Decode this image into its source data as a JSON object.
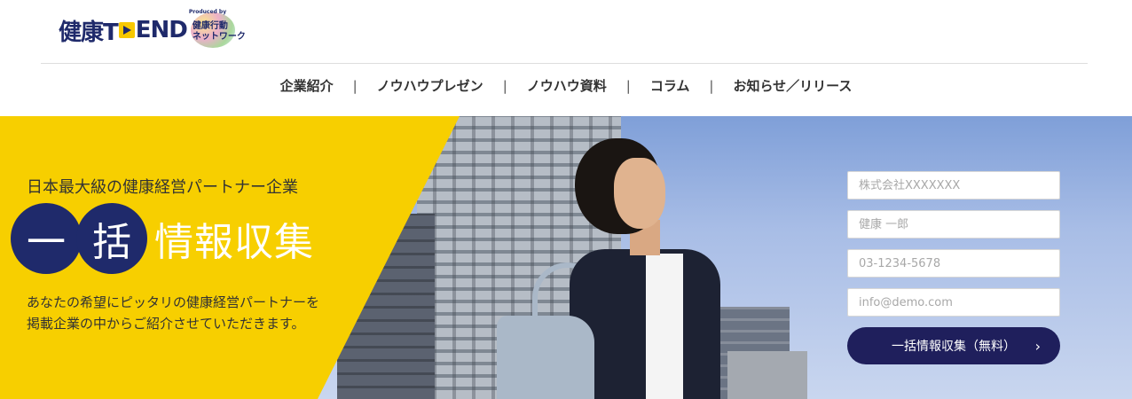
{
  "brand": {
    "logo_text": "健康TREND",
    "produced_by": "Produced by",
    "network_name": "健康行動\nネットワーク"
  },
  "nav": {
    "items": [
      {
        "label": "企業紹介"
      },
      {
        "label": "ノウハウプレゼン"
      },
      {
        "label": "ノウハウ資料"
      },
      {
        "label": "コラム"
      },
      {
        "label": "お知らせ／リリース"
      }
    ],
    "separator": "|"
  },
  "hero": {
    "tagline": "日本最大級の健康経営パートナー企業",
    "headline_circle_1": "一",
    "headline_circle_2": "括",
    "headline_rest": "情報収集",
    "description": "あなたの希望にピッタリの健康経営パートナーを\n掲載企業の中からご紹介させていただきます。"
  },
  "form": {
    "company_placeholder": "株式会社XXXXXXX",
    "name_placeholder": "健康 一郎",
    "phone_placeholder": "03-1234-5678",
    "email_placeholder": "info@demo.com",
    "submit_label": "一括情報収集（無料）",
    "submit_icon": "chevron-right-icon"
  },
  "colors": {
    "brand_navy": "#1f2a6b",
    "hero_yellow": "#f7cf00",
    "button_navy": "#1f1f5c"
  }
}
